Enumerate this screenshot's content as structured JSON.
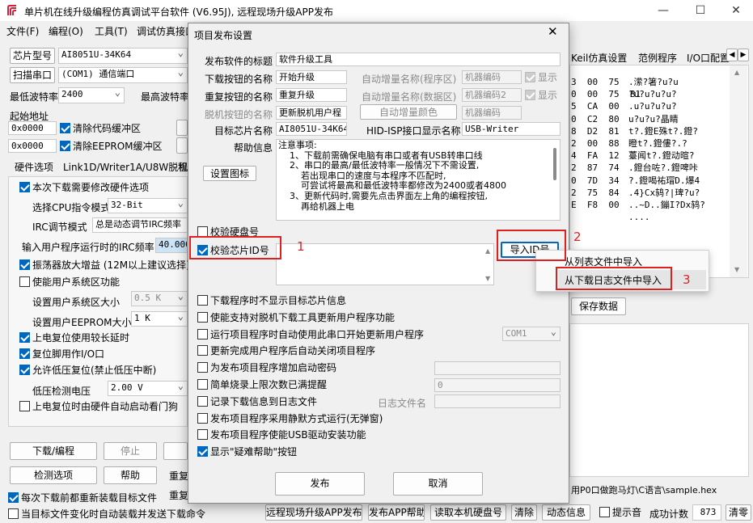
{
  "app": {
    "title": "单片机在线升级编程仿真调试平台软件 (V6.95J), 远程现场升级APP发布",
    "minimize": "—",
    "maximize": "☐",
    "close": "✕"
  },
  "menu": [
    "文件(F)",
    "编程(O)",
    "工具(T)",
    "调试仿真接口"
  ],
  "left": {
    "chip_type_btn": "芯片型号",
    "chip_type_value": "AI8051U-34K64",
    "scan_port_btn": "扫描串口",
    "port_value": "(COM1) 通信端口",
    "min_baud_label": "最低波特率",
    "min_baud_value": "2400",
    "max_baud_label": "最高波特率",
    "start_addr_label": "起始地址",
    "addr1": "0x0000",
    "clear_code": "清除代码缓冲区",
    "addr2": "0x0000",
    "clear_eeprom": "清除EEPROM缓冲区",
    "tabs": [
      "硬件选项",
      "Link1D/Writer1A/U8W脱机",
      "程"
    ],
    "opt_modify_hw": "本次下载需要修改硬件选项",
    "cpu_mode_label": "选择CPU指令模式",
    "cpu_mode_value": "32-Bit",
    "irc_mode_label": "IRC调节模式",
    "irc_mode_value": "总是动态调节IRC频率",
    "irc_freq_label": "输入用户程序运行时的IRC频率",
    "irc_freq_value": "40.000",
    "osc_gain": "振荡器放大增益 (12M以上建议选择)",
    "user_sys_area": "使能用户系统区功能",
    "sys_area_size_label": "设置用户系统区大小",
    "sys_area_size_value": "0.5 K",
    "eeprom_size_label": "设置用户EEPROM大小",
    "eeprom_size_value": "1   K",
    "long_delay": "上电复位使用较长延时",
    "reset_pin_io": "复位脚用作I/O口",
    "low_volt_reset": "允许低压复位(禁止低压中断)",
    "low_volt_label": "低压检测电压",
    "low_volt_value": "2.00 V",
    "watchdog": "上电复位时由硬件自动启动看门狗",
    "download_btn": "下载/编程",
    "stop_btn": "停止",
    "check_btn": "检测选项",
    "help_btn": "帮助",
    "retry1": "重复",
    "retry2": "重复",
    "reload_each": "每次下载前都重新装载目标文件",
    "auto_load": "当目标文件变化时自动装载并发送下载命令"
  },
  "right": {
    "tabs": [
      "Keil仿真设置",
      "范例程序",
      "I/O口配置"
    ],
    "hex_rows": [
      {
        "col": "3  00  75",
        "text": ".潆?箸?u?u"
      },
      {
        "col": "0  00  75  B1",
        "text": "?u?u?u?u?"
      },
      {
        "col": "5  CA  00",
        "text": ".u?u?u?u?"
      },
      {
        "col": "0  C2  80",
        "text": "u?u?u?晶睛"
      },
      {
        "col": "8  D2  81",
        "text": "t?.鐙E殊t?.鐙?"
      },
      {
        "col": "2  00  88",
        "text": "瞪t?.鐙僂?.?"
      },
      {
        "col": "4  FA  12",
        "text": "薹闻t?.鐙动暄?"
      },
      {
        "col": "2  87  74",
        "text": ".鐙台咗?.鐙啤咔"
      },
      {
        "col": "0  7D  34",
        "text": "?.鐙喝祐瑁D.爆4"
      },
      {
        "col": "2  75  84",
        "text": ".4}Cx鸫?|琕?u?"
      },
      {
        "col": "E  F8  00",
        "text": "..~D..鏰I?Dx鸫?"
      },
      {
        "col": "",
        "text": "...."
      }
    ],
    "save_data_btn": "保存数据",
    "file_path": "用P0口做跑马灯\\C语言\\sample.hex"
  },
  "bottom": {
    "remote_btn": "远程现场升级APP发布",
    "publish_help_btn": "发布APP帮助",
    "read_disk_btn": "读取本机硬盘号",
    "clear_btn": "清除",
    "dynamic_btn": "动态信息",
    "beep_label": "提示音",
    "success_label": "成功计数",
    "success_value": "873",
    "clear2_btn": "清零"
  },
  "dialog": {
    "title": "项目发布设置",
    "close": "✕",
    "pub_title_label": "发布软件的标题",
    "pub_title_value": "软件升级工具",
    "dl_btn_label": "下载按钮的名称",
    "dl_btn_value": "开始升级",
    "retry_btn_label": "重复按钮的名称",
    "retry_btn_value": "重复升级",
    "offline_btn_label": "脱机按钮的名称",
    "offline_btn_value": "更新脱机用户程",
    "auto_inc_prog_label": "自动增量名称(程序区)",
    "machine_code1": "机器编码",
    "show1": "显示",
    "auto_inc_data_label": "自动增量名称(数据区)",
    "machine_code2": "机器编码2",
    "show2": "显示",
    "auto_inc_color_btn": "自动增量颜色",
    "machine_code3": "机器编码",
    "target_chip_label": "目标芯片名称",
    "target_chip_value": "AI8051U-34K64",
    "hid_label": "HID-ISP接口显示名称",
    "hid_value": "USB-Writer",
    "help_label": "帮助信息",
    "help_lines": [
      "注意事项:",
      "    1、下载前需确保电脑有串口或者有USB转串口线",
      "    2、串口的最高/最低波特率一般情况下不需设置,",
      "        若出现串口的速度与本程序不匹配时,",
      "        可尝试将最高和最低波特率都修改为2400或者4800",
      "    3、更新代码时,需要先点击界面左上角的编程按钮,",
      "        再给机器上电"
    ],
    "set_icon_btn": "设置图标",
    "verify_disk": "校验硬盘号",
    "verify_chip_id": "校验芯片ID号",
    "import_id_btn": "导入ID号",
    "options": [
      "下载程序时不显示目标芯片信息",
      "使能支持对脱机下载工具更新用户程序功能",
      "运行项目程序时自动使用此串口开始更新用户程序",
      "更新完成用户程序后自动关闭项目程序",
      "为发布项目程序增加启动密码",
      "简单烧录上限次数已满提醒",
      "记录下载信息到日志文件",
      "发布项目程序采用静默方式运行(无弹窗)",
      "发布项目程序使能USB驱动安装功能",
      "显示\"疑难帮助\"按钮"
    ],
    "com_value": "COM1",
    "limit_value": "0",
    "log_name_label": "日志文件名",
    "publish_btn": "发布",
    "cancel_btn": "取消"
  },
  "context_menu": {
    "item1": "从列表文件中导入",
    "item2": "从下载日志文件中导入"
  },
  "markers": {
    "m1": "1",
    "m2": "2",
    "m3": "3"
  },
  "colors": {
    "accent": "#0067c0",
    "marker": "#e02020",
    "selection": "#cce4f7"
  }
}
